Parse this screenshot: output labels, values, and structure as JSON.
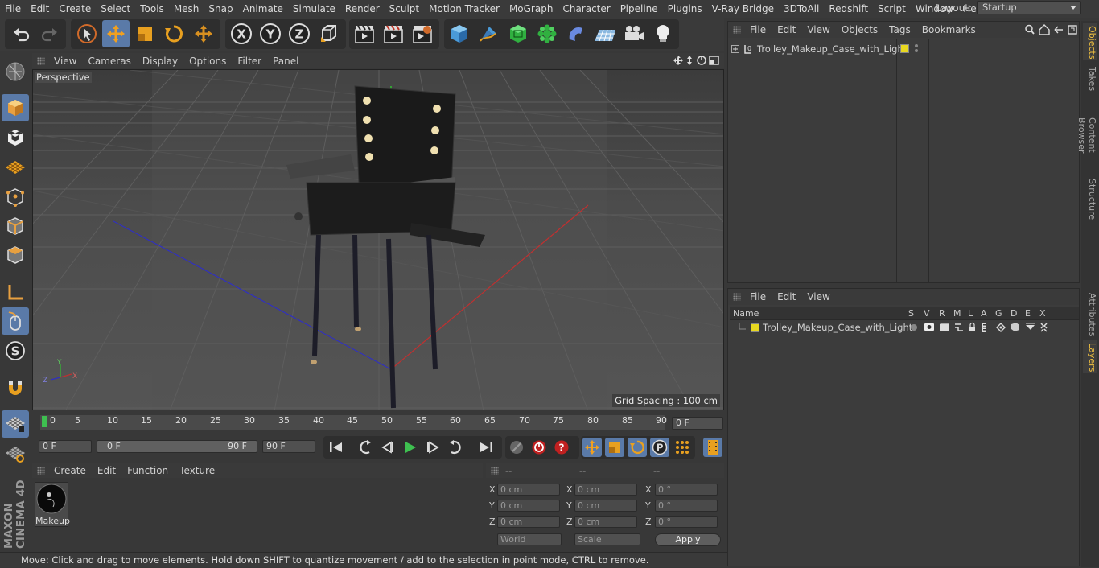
{
  "menubar": {
    "items": [
      "File",
      "Edit",
      "Create",
      "Select",
      "Tools",
      "Mesh",
      "Snap",
      "Animate",
      "Simulate",
      "Render",
      "Sculpt",
      "Motion Tracker",
      "MoGraph",
      "Character",
      "Pipeline",
      "Plugins",
      "V-Ray Bridge",
      "3DToAll",
      "Redshift",
      "Script",
      "Window",
      "Help"
    ],
    "layout_label": "Layout:",
    "layout_value": "Startup"
  },
  "viewport": {
    "menu": [
      "View",
      "Cameras",
      "Display",
      "Options",
      "Filter",
      "Panel"
    ],
    "camera_label": "Perspective",
    "grid_spacing": "Grid Spacing : 100 cm"
  },
  "timeline": {
    "ticks": [
      "0",
      "5",
      "10",
      "15",
      "20",
      "25",
      "30",
      "35",
      "40",
      "45",
      "50",
      "55",
      "60",
      "65",
      "70",
      "75",
      "80",
      "85",
      "90"
    ],
    "current_frame": "0 F",
    "start_frame": "0 F",
    "range_start": "0 F",
    "range_end": "90 F",
    "end_frame": "90 F"
  },
  "material_panel": {
    "menu": [
      "Create",
      "Edit",
      "Function",
      "Texture"
    ],
    "material_name": "Makeup"
  },
  "attributes": {
    "headers": [
      "--",
      "--",
      "--"
    ],
    "pos": {
      "x": "0 cm",
      "y": "0 cm",
      "z": "0 cm"
    },
    "size": {
      "x": "0 cm",
      "y": "0 cm",
      "z": "0 cm"
    },
    "rot": {
      "x": "0 °",
      "y": "0 °",
      "z": "0 °"
    },
    "axis_labels": [
      "X",
      "Y",
      "Z"
    ],
    "coord_mode": "World",
    "scale_mode": "Scale",
    "apply_label": "Apply"
  },
  "objects_panel": {
    "menu": [
      "File",
      "Edit",
      "View",
      "Objects",
      "Tags",
      "Bookmarks"
    ],
    "object_name": "Trolley_Makeup_Case_with_Light"
  },
  "layers_panel": {
    "menu": [
      "File",
      "Edit",
      "View"
    ],
    "col_name": "Name",
    "cols": [
      "S",
      "V",
      "R",
      "M",
      "L",
      "A",
      "G",
      "D",
      "E",
      "X"
    ],
    "layer_name": "Trolley_Makeup_Case_with_Light"
  },
  "right_tabs": [
    "Objects",
    "Takes",
    "Content Browser",
    "Structure",
    "Attributes",
    "Layers"
  ],
  "status": "Move: Click and drag to move elements. Hold down SHIFT to quantize movement / add to the selection in point mode, CTRL to remove.",
  "brand": "MAXON CINEMA 4D",
  "colors": {
    "accent": "#5a7aa8",
    "layer_yellow": "#e8d820",
    "highlight": "#f0c040"
  }
}
